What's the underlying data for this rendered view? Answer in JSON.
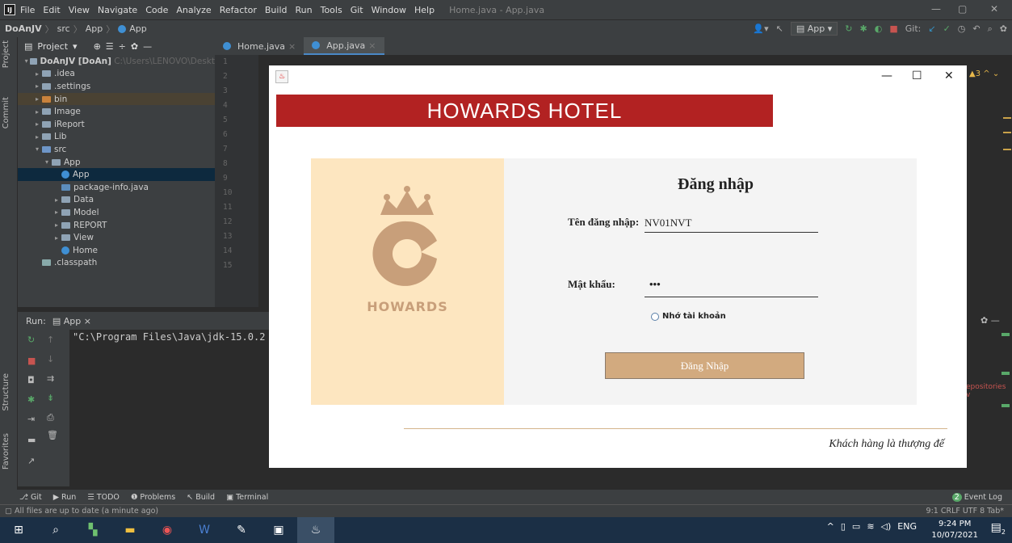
{
  "ide": {
    "menu": [
      "File",
      "Edit",
      "View",
      "Navigate",
      "Code",
      "Analyze",
      "Refactor",
      "Build",
      "Run",
      "Tools",
      "Git",
      "Window",
      "Help"
    ],
    "window_title": "Home.java - App.java",
    "breadcrumb": [
      "DoAnJV",
      "src",
      "App",
      "App"
    ],
    "run_config": "App",
    "git_label": "Git:",
    "project_label": "Project",
    "tree": [
      {
        "label": "DoAnJV [DoAn]",
        "extra": "C:\\Users\\LENOVO\\Deskt",
        "indent": 0
      },
      {
        "label": ".idea",
        "indent": 1
      },
      {
        "label": ".settings",
        "indent": 1
      },
      {
        "label": "bin",
        "indent": 1
      },
      {
        "label": "Image",
        "indent": 1
      },
      {
        "label": "iReport",
        "indent": 1
      },
      {
        "label": "Lib",
        "indent": 1
      },
      {
        "label": "src",
        "indent": 1
      },
      {
        "label": "App",
        "indent": 2
      },
      {
        "label": "App",
        "indent": 3
      },
      {
        "label": "package-info.java",
        "indent": 3
      },
      {
        "label": "Data",
        "indent": 2
      },
      {
        "label": "Model",
        "indent": 2
      },
      {
        "label": "REPORT",
        "indent": 2
      },
      {
        "label": "View",
        "indent": 2
      },
      {
        "label": "Home",
        "indent": 3
      },
      {
        "label": ".classpath",
        "indent": 1
      }
    ],
    "editor_tabs": [
      "Home.java",
      "App.java"
    ],
    "line_numbers": [
      "1",
      "2",
      "3",
      "4",
      "5",
      "6",
      "7",
      "8",
      "9",
      "10",
      "11",
      "12",
      "13",
      "14",
      "15"
    ],
    "warning_count": "3",
    "run_label": "Run:",
    "run_tab": "App",
    "console_text": "\"C:\\Program Files\\Java\\jdk-15.0.2",
    "repo_hint": "epositories v",
    "bottom_tabs": [
      "Git",
      "Run",
      "TODO",
      "Problems",
      "Build",
      "Terminal"
    ],
    "event_log": "Event Log",
    "event_count": "2",
    "status_left": "All files are up to date (a minute ago)",
    "status_right": "9:1  CRLF  UTF 8  Tab*",
    "side_tabs": [
      "Project",
      "Commit",
      "Structure",
      "Favorites"
    ]
  },
  "taskbar": {
    "lang": "ENG",
    "time": "9:24 PM",
    "date": "10/07/2021",
    "notif_count": "2"
  },
  "dialog": {
    "banner": "HOWARDS HOTEL",
    "logo_text": "HOWARDS",
    "title": "Đăng nhập",
    "username_label": "Tên đăng nhập:",
    "username_value": "NV01NVT",
    "password_label": "Mật khẩu:",
    "password_value": "•••",
    "remember_label": "Nhớ tài khoản",
    "login_button": "Đăng Nhập",
    "slogan": "Khách hàng là thượng đế",
    "colors": {
      "banner": "#b22222",
      "panel": "#fde6c0",
      "button": "#d2aa7f",
      "logo": "#c89f7a"
    }
  }
}
